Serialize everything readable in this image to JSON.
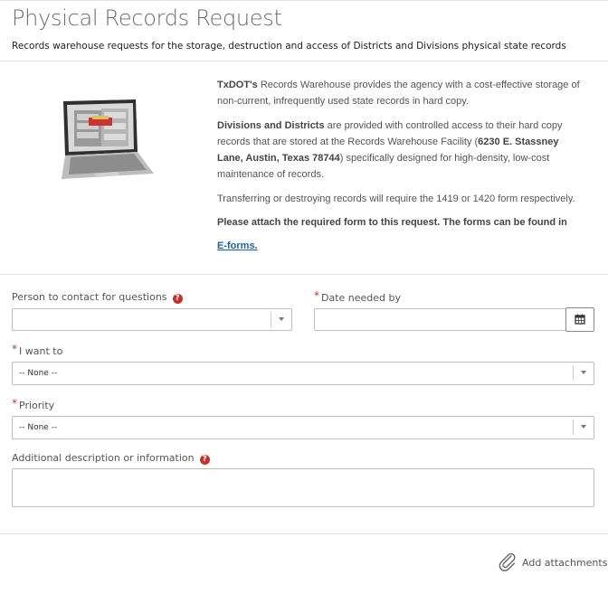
{
  "header": {
    "title": "Physical Records Request",
    "subtitle": "Records warehouse requests for the storage, destruction and access of Districts and Divisions physical state records"
  },
  "info": {
    "p1_bold": "TxDOT's",
    "p1_rest": " Records Warehouse provides the agency with a cost-effective storage of non-current, infrequently used state records in hard copy.",
    "p2_bold": "Divisions and Districts",
    "p2_mid": " are provided with controlled access to their hard copy records that are stored at the Records Warehouse Facility (",
    "p2_addr": "6230 E. Stassney Lane, Austin, Texas 78744",
    "p2_end": ") specifically designed for high-density, low-cost maintenance of records.",
    "p3": "Transferring or destroying records will require the 1419 or 1420 form respectively.",
    "p4": "Please attach the required form to this request. The forms can be found in",
    "link": "E-forms."
  },
  "form": {
    "contact_label": "Person to contact for questions",
    "contact_value": "",
    "date_label": "Date needed by",
    "date_value": "",
    "want_label": "I want to",
    "want_value": "-- None --",
    "priority_label": "Priority",
    "priority_value": "-- None --",
    "description_label": "Additional description or information",
    "help_glyph": "?",
    "required_glyph": "*"
  },
  "footer": {
    "attachments_label": "Add attachments"
  },
  "colors": {
    "required": "#c0392b",
    "help": "#c9302c",
    "link": "#1f5fa8"
  }
}
